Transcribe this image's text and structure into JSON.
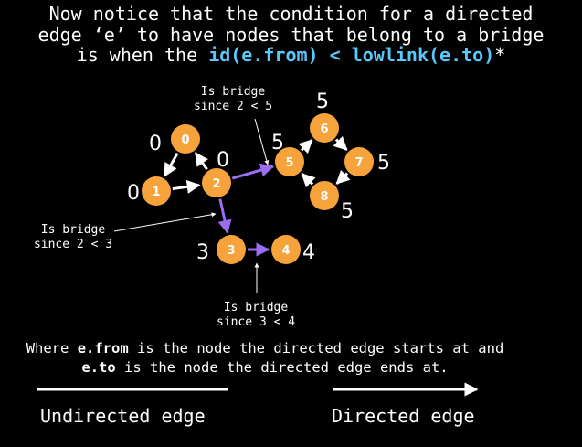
{
  "heading": {
    "line1": "Now notice that the condition for a directed",
    "line2": "edge ‘e’ to have nodes that belong to a bridge",
    "line3_prefix": "is when the ",
    "condition": "id(e.from) < lowlink(e.to)",
    "line3_suffix": "*"
  },
  "colors": {
    "background": "#000000",
    "node_fill": "#f5a33a",
    "bridge_edge": "#9b6df0",
    "edge": "#ffffff",
    "highlight_text": "#5ac8fa"
  },
  "nodes": [
    {
      "id": "0",
      "lowlink": "0"
    },
    {
      "id": "1",
      "lowlink": "0"
    },
    {
      "id": "2",
      "lowlink": "0"
    },
    {
      "id": "3",
      "lowlink": "3"
    },
    {
      "id": "4",
      "lowlink": "4"
    },
    {
      "id": "5",
      "lowlink": "5"
    },
    {
      "id": "6",
      "lowlink": "5"
    },
    {
      "id": "7",
      "lowlink": "5"
    },
    {
      "id": "8",
      "lowlink": "5"
    }
  ],
  "edges": [
    {
      "from": "0",
      "to": "1",
      "bridge": false
    },
    {
      "from": "1",
      "to": "2",
      "bridge": false
    },
    {
      "from": "2",
      "to": "0",
      "bridge": false
    },
    {
      "from": "2",
      "to": "5",
      "bridge": true
    },
    {
      "from": "2",
      "to": "3",
      "bridge": true
    },
    {
      "from": "3",
      "to": "4",
      "bridge": true
    },
    {
      "from": "5",
      "to": "6",
      "bridge": false
    },
    {
      "from": "6",
      "to": "7",
      "bridge": false
    },
    {
      "from": "7",
      "to": "8",
      "bridge": false
    },
    {
      "from": "8",
      "to": "5",
      "bridge": false
    }
  ],
  "annotations": [
    {
      "line1": "Is bridge",
      "line2": "since 2 < 5"
    },
    {
      "line1": "Is bridge",
      "line2": "since 2 < 3"
    },
    {
      "line1": "Is bridge",
      "line2": "since 3 < 4"
    }
  ],
  "description": {
    "part1": "Where ",
    "from_term": "e.from",
    "part2": " is the node the directed edge starts at and",
    "to_term": "e.to",
    "part3": " is the node the directed edge ends at."
  },
  "legend": {
    "undirected_label": "Undirected edge",
    "directed_label": "Directed edge"
  }
}
